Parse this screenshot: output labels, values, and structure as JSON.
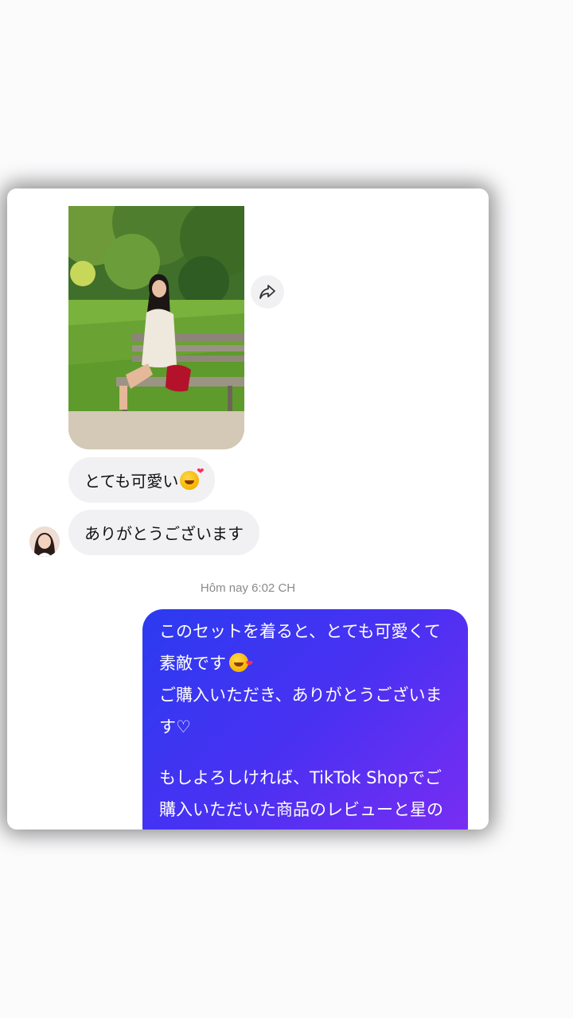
{
  "messages": {
    "incoming_1": "とても可愛い",
    "incoming_2": "ありがとうございます",
    "timestamp": "Hôm nay 6:02 CH",
    "outgoing": {
      "line1": "このセットを着ると、とても可愛くて",
      "line2": "素敵です",
      "line3": "ご購入いただき、ありがとうございま",
      "line4": "す♡",
      "line5": "もしよろしければ、TikTok Shopでご",
      "line6": "購入いただいた商品のレビューと星の"
    }
  },
  "icons": {
    "share": "share-arrow-icon",
    "emoji": "smiling-face-with-hearts-icon"
  },
  "colors": {
    "incoming_bubble": "#f1f1f3",
    "outgoing_gradient_start": "#2b3bf0",
    "outgoing_gradient_end": "#7b2df2",
    "timestamp": "#8a8a8e"
  }
}
